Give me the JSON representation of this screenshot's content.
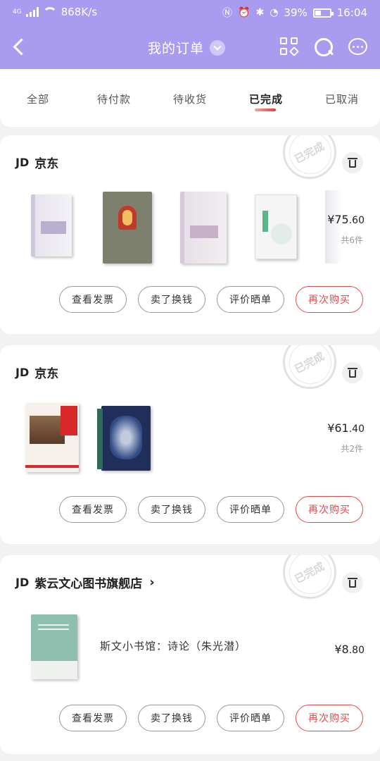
{
  "status": {
    "net": "4G",
    "speed": "868K/s",
    "battery": "39%",
    "time": "16:04"
  },
  "header": {
    "title": "我的订单"
  },
  "tabs": [
    "全部",
    "待付款",
    "待收货",
    "已完成",
    "已取消"
  ],
  "orders": [
    {
      "shop": "京东",
      "shop_prefix": "JD",
      "stamp": "已完成",
      "price_int": "¥75",
      "price_dec": ".60",
      "count": "共6件",
      "buttons": [
        "查看发票",
        "卖了换钱",
        "评价晒单",
        "再次购买"
      ]
    },
    {
      "shop": "京东",
      "shop_prefix": "JD",
      "stamp": "已完成",
      "price_int": "¥61",
      "price_dec": ".40",
      "count": "共2件",
      "buttons": [
        "查看发票",
        "卖了换钱",
        "评价晒单",
        "再次购买"
      ]
    },
    {
      "shop": "紫云文心图书旗舰店",
      "shop_prefix": "JD",
      "stamp": "已完成",
      "item_title": "斯文小书馆：诗论（朱光潜）",
      "price_int": "¥8",
      "price_dec": ".80",
      "buttons": [
        "查看发票",
        "卖了换钱",
        "评价晒单",
        "再次购买"
      ]
    }
  ],
  "colors": {
    "header": "#a99cf0",
    "accent": "#e84a4a"
  }
}
